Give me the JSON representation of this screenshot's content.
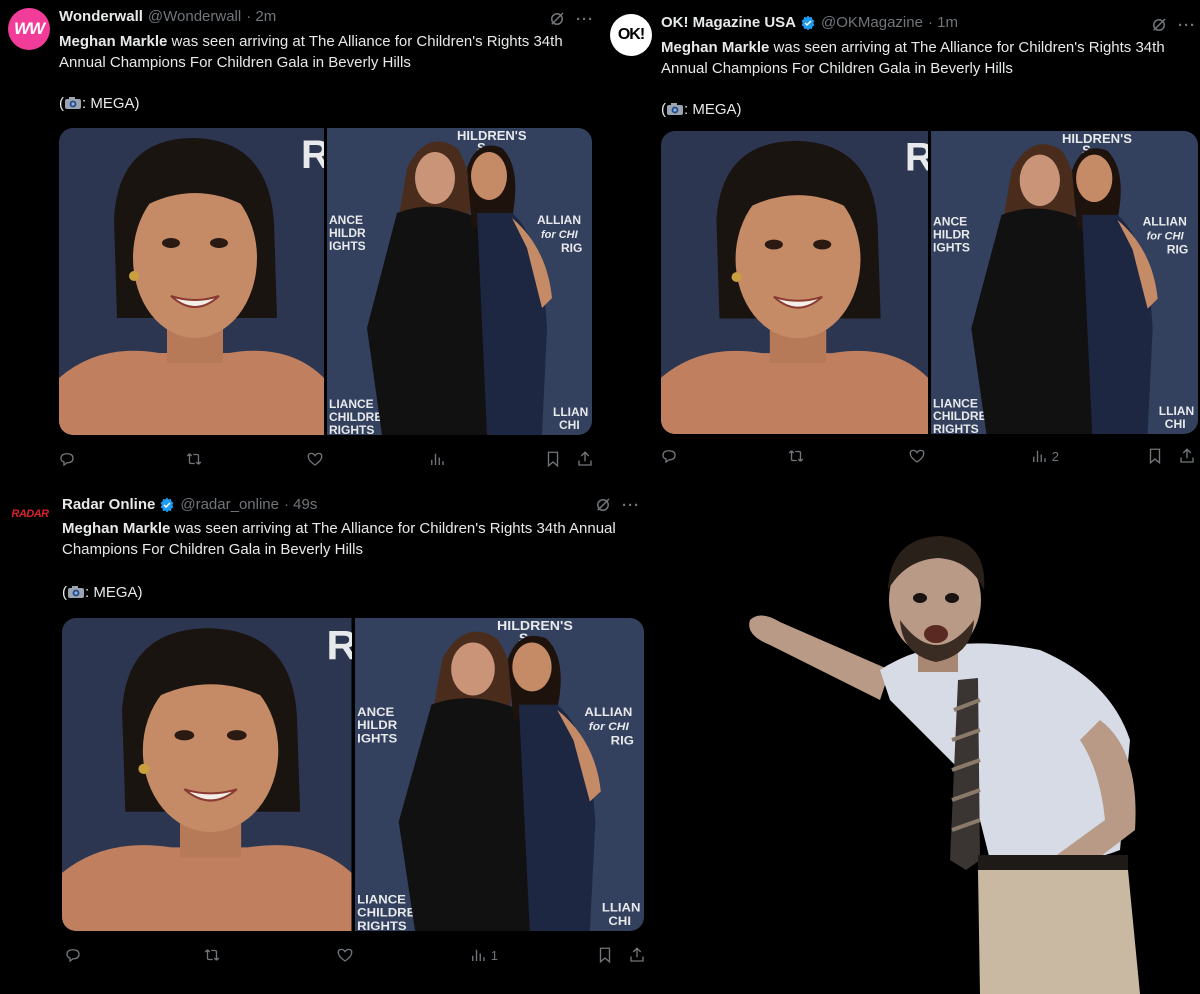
{
  "tweets": [
    {
      "avatar_text": "WW",
      "name": "Wonderwall",
      "verified": false,
      "handle": "@Wonderwall",
      "time": "· 2m",
      "text_bold": "Meghan Markle",
      "text_rest": " was seen arriving at The Alliance for Children's Rights 34th Annual Champions For Children Gala in Beverly Hills",
      "credit_open": "(",
      "credit_text": ": MEGA)",
      "views": "",
      "photo_left_letter": "R",
      "photo_right": {
        "top": "HILDREN'S",
        "top2": "S",
        "left": [
          "ANCE",
          "HILDR",
          "IGHTS"
        ],
        "right": [
          "ALLIAN",
          "for CHI",
          "RIG"
        ],
        "bottom": [
          "LIANCE",
          "CHILDREN",
          "RIGHTS"
        ],
        "bottom_right": [
          "LLIAN",
          "CHI"
        ]
      }
    },
    {
      "avatar_text": "OK!",
      "name": "OK! Magazine USA",
      "verified": true,
      "handle": "@OKMagazine",
      "time": "· 1m",
      "text_bold": "Meghan Markle",
      "text_rest": " was seen arriving at The Alliance for Children's Rights 34th Annual Champions For Children Gala in Beverly Hills",
      "credit_open": "(",
      "credit_text": ": MEGA)",
      "views": "2",
      "photo_left_letter": "R",
      "photo_right": {
        "top": "HILDREN'S",
        "top2": "S",
        "left": [
          "ANCE",
          "HILDR",
          "IGHTS"
        ],
        "right": [
          "ALLIAN",
          "for CHI",
          "RIG"
        ],
        "bottom": [
          "LIANCE",
          "CHILDREN",
          "RIGHTS"
        ],
        "bottom_right": [
          "LLIAN",
          "CHI"
        ]
      }
    },
    {
      "avatar_text": "RADAR",
      "name": "Radar Online",
      "verified": true,
      "handle": "@radar_online",
      "time": "· 49s",
      "text_bold": "Meghan Markle",
      "text_rest": " was seen arriving at The Alliance for Children's Rights 34th Annual Champions For Children Gala in Beverly Hills",
      "credit_open": "(",
      "credit_text": ": MEGA)",
      "views": "1",
      "photo_left_letter": "R",
      "photo_right": {
        "top": "HILDREN'S",
        "top2": "S",
        "left": [
          "ANCE",
          "HILDR",
          "IGHTS"
        ],
        "right": [
          "ALLIAN",
          "for CHI",
          "RIG"
        ],
        "bottom": [
          "LIANCE",
          "CHILDREN",
          "RIGHTS"
        ],
        "bottom_right": [
          "LLIAN",
          "CHI"
        ]
      }
    }
  ],
  "colors": {
    "background": "#000000",
    "text": "#e7e9ea",
    "muted": "#71767b",
    "verified": "#1d9bf0",
    "wonderwall": "#f23c9a",
    "radar": "#d8232a",
    "backdrop": "#2c3650"
  },
  "icons": [
    "reply-icon",
    "retweet-icon",
    "like-icon",
    "views-icon",
    "bookmark-icon",
    "share-icon",
    "grok-icon",
    "more-icon",
    "verified-icon",
    "camera-icon"
  ]
}
